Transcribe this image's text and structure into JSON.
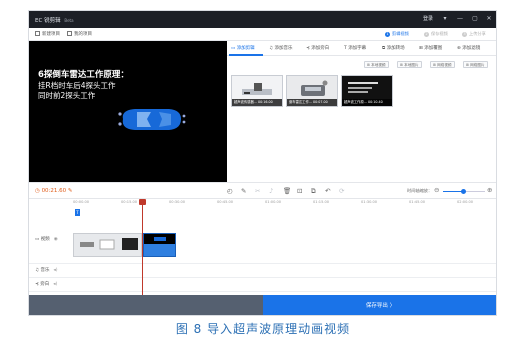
{
  "window": {
    "logo": "EC",
    "title": "锐剪辑",
    "badge": "Beta",
    "user": "登录",
    "controls": [
      "▾",
      "—",
      "▢",
      "✕"
    ]
  },
  "menu": {
    "new_project": "新建项目",
    "my_projects": "我的项目"
  },
  "steps": [
    {
      "num": "1",
      "label": "剪辑视频",
      "active": true
    },
    {
      "num": "2",
      "label": "保存视频",
      "active": false
    },
    {
      "num": "3",
      "label": "上传分享",
      "active": false
    }
  ],
  "preview": {
    "heading": "6探倒车雷达工作原理：",
    "line1": "挂R档时车后4探头工作",
    "line2": "同时前2探头工作",
    "time": "00:21.60/00:31.00"
  },
  "tabs": [
    "添加剪辑",
    "添加音乐",
    "添加旁白",
    "添加字幕",
    "添加转场",
    "添加覆图",
    "添加滤镜"
  ],
  "sub_buttons": [
    "本地视频",
    "本地图片",
    "网络视频",
    "网络图片"
  ],
  "clips": [
    {
      "caption": "超声波传感器...",
      "duration": "00:16.00"
    },
    {
      "caption": "倒车雷达工作...",
      "duration": "00:07.00"
    },
    {
      "caption": "超声波工作原...",
      "duration": "00:10.40"
    }
  ],
  "toolbar": {
    "current_time": "00:21.60",
    "zoom_label": "时间轴缩放："
  },
  "ruler": [
    "00:00.00",
    "00:15.00",
    "00:30.00",
    "00:45.00",
    "01:00.00",
    "01:15.00",
    "01:30.00",
    "01:45.00",
    "02:00.00"
  ],
  "tracks": {
    "marker": "T",
    "video": "视频",
    "music": "音乐",
    "voice": "旁白"
  },
  "save": {
    "label": "保存导出 〉"
  },
  "caption": "图 8  导入超声波原理动画视频",
  "colors": {
    "accent": "#1a73e8",
    "time": "#e05c1a",
    "playhead": "#c0392b",
    "caption": "#2b6fb4"
  },
  "icons": [
    "play-icon",
    "prev-icon",
    "next-icon",
    "fullscreen-icon",
    "clock-icon",
    "pen-icon",
    "scissors-icon",
    "bell-icon",
    "trash-icon",
    "crop-icon",
    "copy-icon",
    "undo-icon",
    "rotate-icon",
    "zoom-out-icon",
    "zoom-in-icon"
  ]
}
